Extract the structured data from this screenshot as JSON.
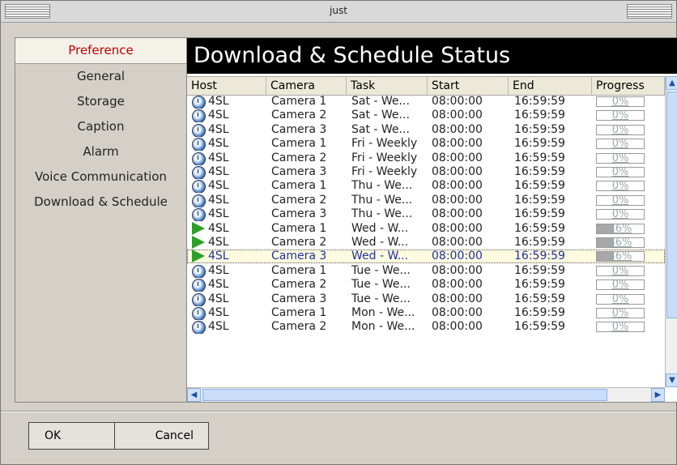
{
  "window": {
    "title": "just"
  },
  "sidebar": {
    "items": [
      {
        "label": "Preference",
        "active": true
      },
      {
        "label": "General"
      },
      {
        "label": "Storage"
      },
      {
        "label": "Caption"
      },
      {
        "label": "Alarm"
      },
      {
        "label": "Voice Communication"
      },
      {
        "label": "Download & Schedule"
      }
    ]
  },
  "panel": {
    "title": "Download & Schedule Status",
    "columns": [
      "Host",
      "Camera",
      "Task",
      "Start",
      "End",
      "Progress"
    ],
    "rows": [
      {
        "icon": "clock-icon",
        "host": "4SL",
        "camera": "Camera 1",
        "task": "Sat - We...",
        "start": "08:00:00",
        "end": "16:59:59",
        "progress": "0%",
        "progress_value": 0
      },
      {
        "icon": "clock-icon",
        "host": "4SL",
        "camera": "Camera 2",
        "task": "Sat - We...",
        "start": "08:00:00",
        "end": "16:59:59",
        "progress": "0%",
        "progress_value": 0
      },
      {
        "icon": "clock-icon",
        "host": "4SL",
        "camera": "Camera 3",
        "task": "Sat - We...",
        "start": "08:00:00",
        "end": "16:59:59",
        "progress": "0%",
        "progress_value": 0
      },
      {
        "icon": "clock-icon",
        "host": "4SL",
        "camera": "Camera 1",
        "task": "Fri - Weekly",
        "start": "08:00:00",
        "end": "16:59:59",
        "progress": "0%",
        "progress_value": 0
      },
      {
        "icon": "clock-icon",
        "host": "4SL",
        "camera": "Camera 2",
        "task": "Fri - Weekly",
        "start": "08:00:00",
        "end": "16:59:59",
        "progress": "0%",
        "progress_value": 0
      },
      {
        "icon": "clock-icon",
        "host": "4SL",
        "camera": "Camera 3",
        "task": "Fri - Weekly",
        "start": "08:00:00",
        "end": "16:59:59",
        "progress": "0%",
        "progress_value": 0
      },
      {
        "icon": "clock-icon",
        "host": "4SL",
        "camera": "Camera 1",
        "task": "Thu - We...",
        "start": "08:00:00",
        "end": "16:59:59",
        "progress": "0%",
        "progress_value": 0
      },
      {
        "icon": "clock-icon",
        "host": "4SL",
        "camera": "Camera 2",
        "task": "Thu - We...",
        "start": "08:00:00",
        "end": "16:59:59",
        "progress": "0%",
        "progress_value": 0
      },
      {
        "icon": "clock-icon",
        "host": "4SL",
        "camera": "Camera 3",
        "task": "Thu - We...",
        "start": "08:00:00",
        "end": "16:59:59",
        "progress": "0%",
        "progress_value": 0
      },
      {
        "icon": "play-icon",
        "host": "4SL",
        "camera": "Camera 1",
        "task": "Wed - W...",
        "start": "08:00:00",
        "end": "16:59:59",
        "progress": "36%",
        "progress_value": 0.36
      },
      {
        "icon": "play-icon",
        "host": "4SL",
        "camera": "Camera 2",
        "task": "Wed - W...",
        "start": "08:00:00",
        "end": "16:59:59",
        "progress": "36%",
        "progress_value": 0.36
      },
      {
        "icon": "play-icon",
        "host": "4SL",
        "camera": "Camera 3",
        "task": "Wed - W...",
        "start": "08:00:00",
        "end": "16:59:59",
        "progress": "36%",
        "progress_value": 0.36,
        "selected": true
      },
      {
        "icon": "clock-icon",
        "host": "4SL",
        "camera": "Camera 1",
        "task": "Tue - We...",
        "start": "08:00:00",
        "end": "16:59:59",
        "progress": "0%",
        "progress_value": 0
      },
      {
        "icon": "clock-icon",
        "host": "4SL",
        "camera": "Camera 2",
        "task": "Tue - We...",
        "start": "08:00:00",
        "end": "16:59:59",
        "progress": "0%",
        "progress_value": 0
      },
      {
        "icon": "clock-icon",
        "host": "4SL",
        "camera": "Camera 3",
        "task": "Tue - We...",
        "start": "08:00:00",
        "end": "16:59:59",
        "progress": "0%",
        "progress_value": 0
      },
      {
        "icon": "clock-icon",
        "host": "4SL",
        "camera": "Camera 1",
        "task": "Mon - We...",
        "start": "08:00:00",
        "end": "16:59:59",
        "progress": "0%",
        "progress_value": 0
      },
      {
        "icon": "clock-icon",
        "host": "4SL",
        "camera": "Camera 2",
        "task": "Mon - We...",
        "start": "08:00:00",
        "end": "16:59:59",
        "progress": "0%",
        "progress_value": 0
      }
    ]
  },
  "buttons": {
    "ok": "OK",
    "cancel": "Cancel"
  },
  "colors": {
    "active_sidebar": "#c00000",
    "selected_text": "#1f2fa0",
    "play": "#2da02a"
  }
}
